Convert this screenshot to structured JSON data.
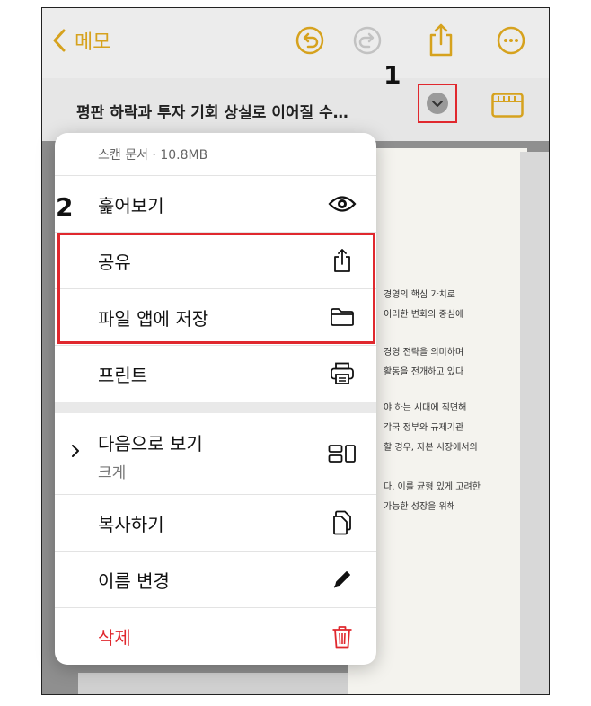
{
  "colors": {
    "accent": "#d6a21e",
    "danger": "#e0282e",
    "highlight": "#e0282e"
  },
  "nav": {
    "back_label": "메모",
    "icons": [
      "chevron-left-icon",
      "undo-icon",
      "redo-icon",
      "share-icon",
      "more-icon"
    ]
  },
  "note": {
    "title": "평판 하락과 투자 기회 상실로 이어질 수…"
  },
  "annotations": {
    "step1": "1",
    "step2": "2"
  },
  "menu": {
    "header": "스캔 문서 · 10.8MB",
    "items": [
      {
        "label": "훑어보기",
        "icon": "eye-icon"
      },
      {
        "label": "공유",
        "icon": "share-icon"
      },
      {
        "label": "파일 앱에 저장",
        "icon": "folder-icon"
      },
      {
        "label": "프린트",
        "icon": "printer-icon"
      },
      {
        "label": "다음으로 보기",
        "sub": "크게",
        "icon": "view-options-icon"
      },
      {
        "label": "복사하기",
        "icon": "copy-icon"
      },
      {
        "label": "이름 변경",
        "icon": "pencil-icon"
      },
      {
        "label": "삭제",
        "icon": "trash-icon"
      }
    ]
  },
  "document_lines": [
    "경영의 핵심 가치로",
    "이러한 변화의 중심에",
    "경영 전략을 의미하며",
    "활동을 전개하고 있다",
    "야 하는 시대에 직면해",
    "각국 정부와 규제기관",
    "할 경우, 자본 시장에서의",
    "다. 이를 균형 있게 고려한",
    "가능한 성장을 위해"
  ]
}
